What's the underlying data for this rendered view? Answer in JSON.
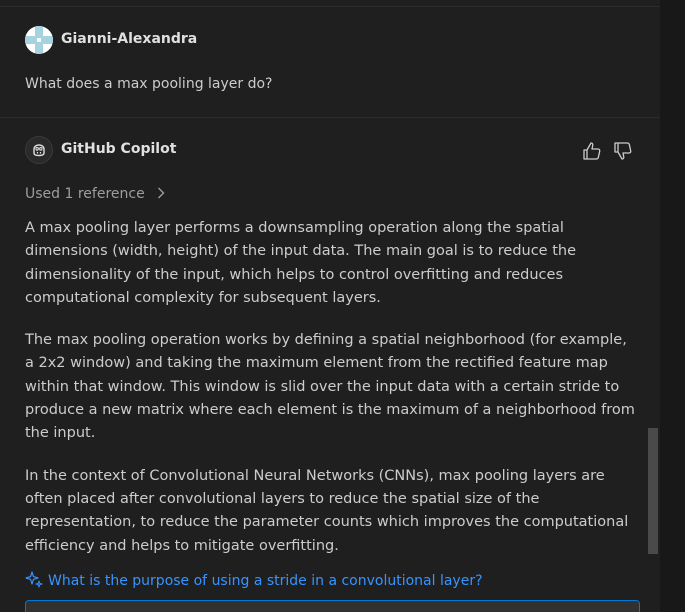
{
  "user": {
    "name": "Gianni-Alexandra",
    "message": "What does a max pooling layer do?"
  },
  "assistant": {
    "name": "GitHub Copilot",
    "reference_label": "Used 1 reference",
    "paragraphs": [
      "A max pooling layer performs a downsampling operation along the spatial dimensions (width, height) of the input data. The main goal is to reduce the dimensionality of the input, which helps to control overfitting and reduces computational complexity for subsequent layers.",
      "The max pooling operation works by defining a spatial neighborhood (for example, a 2x2 window) and taking the maximum element from the rectified feature map within that window. This window is slid over the input data with a certain stride to produce a new matrix where each element is the maximum of a neighborhood from the input.",
      "In the context of Convolutional Neural Networks (CNNs), max pooling layers are often placed after convolutional layers to reduce the spatial size of the representation, to reduce the parameter counts which improves the computational efficiency and helps to mitigate overfitting."
    ]
  },
  "followup": {
    "text": "What is the purpose of using a stride in a convolutional layer?"
  },
  "icons": {
    "thumbs_up": "thumbs-up-icon",
    "thumbs_down": "thumbs-down-icon",
    "sparkle": "sparkle-icon",
    "chevron": "chevron-right-icon"
  },
  "colors": {
    "background": "#1f1f1f",
    "text": "#cccccc",
    "link": "#3794ff",
    "focus_border": "#0078d4"
  }
}
